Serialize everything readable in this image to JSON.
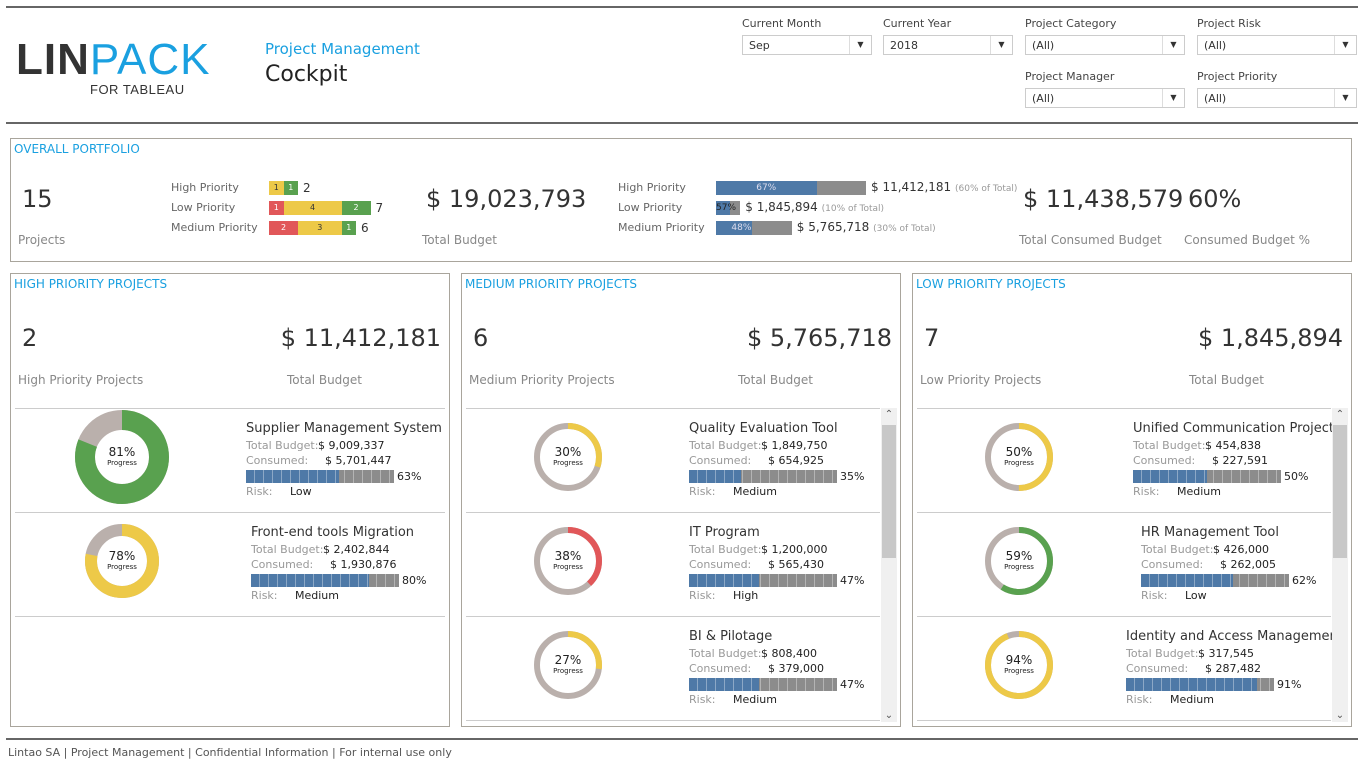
{
  "header": {
    "logo_main_dark": "LIN",
    "logo_main_blue": "PACK",
    "logo_sub": "FOR TABLEAU",
    "subtitle": "Project Management",
    "title": "Cockpit"
  },
  "filters": [
    {
      "label": "Current Month",
      "value": "Sep"
    },
    {
      "label": "Current Year",
      "value": "2018"
    },
    {
      "label": "Project Category",
      "value": "(All)"
    },
    {
      "label": "Project Risk",
      "value": "(All)"
    },
    {
      "label": "Project Manager",
      "value": "(All)"
    },
    {
      "label": "Project Priority",
      "value": "(All)"
    }
  ],
  "colors": {
    "accent": "#1aa0e0",
    "red": "#e15759",
    "yellow": "#edc948",
    "green": "#59a14f",
    "blue": "#4e79a7",
    "gray": "#8c8c8c",
    "donut_rest": "#bab0ac"
  },
  "overall": {
    "title": "OVERALL PORTFOLIO",
    "projects_value": "15",
    "projects_label": "Projects",
    "risk_rows": [
      {
        "label": "High Priority",
        "segments": [
          {
            "risk": "yellow",
            "count": 1
          },
          {
            "risk": "green",
            "count": 1
          }
        ],
        "total": "2"
      },
      {
        "label": "Low Priority",
        "segments": [
          {
            "risk": "red",
            "count": 1
          },
          {
            "risk": "yellow",
            "count": 4
          },
          {
            "risk": "green",
            "count": 2
          }
        ],
        "total": "7"
      },
      {
        "label": "Medium Priority",
        "segments": [
          {
            "risk": "red",
            "count": 2
          },
          {
            "risk": "yellow",
            "count": 3
          },
          {
            "risk": "green",
            "count": 1
          }
        ],
        "total": "6"
      }
    ],
    "total_budget_value": "$ 19,023,793",
    "total_budget_label": "Total Budget",
    "budget_rows": [
      {
        "label": "High Priority",
        "budget": 11412181,
        "consumed_pct": 67,
        "pct_text": "67%",
        "amount": "$ 11,412,181",
        "share": "(60% of Total)"
      },
      {
        "label": "Low Priority",
        "budget": 1845894,
        "consumed_pct": 57,
        "pct_text": "57%",
        "amount": "$ 1,845,894",
        "share": "(10% of Total)"
      },
      {
        "label": "Medium Priority",
        "budget": 5765718,
        "consumed_pct": 48,
        "pct_text": "48%",
        "amount": "$ 5,765,718",
        "share": "(30% of Total)"
      }
    ],
    "consumed_value": "$ 11,438,579",
    "consumed_label": "Total Consumed Budget",
    "consumed_pct_value": "60%",
    "consumed_pct_label": "Consumed Budget %"
  },
  "sections": [
    {
      "title": "HIGH PRIORITY PROJECTS",
      "count": "2",
      "count_label": "High Priority Projects",
      "budget": "$ 11,412,181",
      "budget_label": "Total Budget",
      "scrollable": false,
      "projects": [
        {
          "name": "Supplier Management System",
          "progress": 81,
          "color": "green",
          "budget": "$ 9,009,337",
          "consumed": "$ 5,701,447",
          "consumed_pct": 63,
          "risk": "Low"
        },
        {
          "name": "Front-end tools Migration",
          "progress": 78,
          "color": "yellow",
          "budget": "$ 2,402,844",
          "consumed": "$ 1,930,876",
          "consumed_pct": 80,
          "risk": "Medium"
        }
      ]
    },
    {
      "title": "MEDIUM PRIORITY PROJECTS",
      "count": "6",
      "count_label": "Medium Priority Projects",
      "budget": "$ 5,765,718",
      "budget_label": "Total Budget",
      "scrollable": true,
      "projects": [
        {
          "name": "Quality Evaluation Tool",
          "progress": 30,
          "color": "yellow",
          "budget": "$ 1,849,750",
          "consumed": "$ 654,925",
          "consumed_pct": 35,
          "risk": "Medium"
        },
        {
          "name": "IT Program",
          "progress": 38,
          "color": "red",
          "budget": "$ 1,200,000",
          "consumed": "$ 565,430",
          "consumed_pct": 47,
          "risk": "High"
        },
        {
          "name": "BI & Pilotage",
          "progress": 27,
          "color": "yellow",
          "budget": "$ 808,400",
          "consumed": "$ 379,000",
          "consumed_pct": 47,
          "risk": "Medium"
        }
      ]
    },
    {
      "title": "LOW PRIORITY PROJECTS",
      "count": "7",
      "count_label": "Low Priority Projects",
      "budget": "$ 1,845,894",
      "budget_label": "Total Budget",
      "scrollable": true,
      "projects": [
        {
          "name": "Unified Communication Project",
          "progress": 50,
          "color": "yellow",
          "budget": "$ 454,838",
          "consumed": "$ 227,591",
          "consumed_pct": 50,
          "risk": "Medium"
        },
        {
          "name": "HR Management Tool",
          "progress": 59,
          "color": "green",
          "budget": "$ 426,000",
          "consumed": "$ 262,005",
          "consumed_pct": 62,
          "risk": "Low"
        },
        {
          "name": "Identity and Access Management",
          "progress": 94,
          "color": "yellow",
          "budget": "$ 317,545",
          "consumed": "$ 287,482",
          "consumed_pct": 91,
          "risk": "Medium"
        }
      ]
    }
  ],
  "card_labels": {
    "total_budget": "Total Budget:",
    "consumed": "Consumed:",
    "risk": "Risk:",
    "progress": "Progress"
  },
  "footer": "Lintao SA | Project Management  | Confidential Information | For internal use only"
}
